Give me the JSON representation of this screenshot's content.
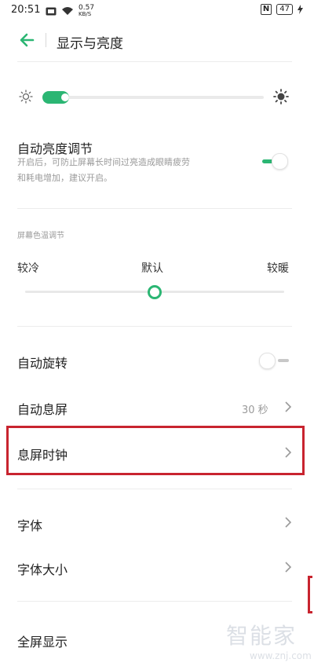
{
  "status_bar": {
    "time": "20:51",
    "speed_value": "0.57",
    "speed_unit": "KB/S",
    "battery": "47",
    "nfc": "N"
  },
  "header": {
    "title": "显示与亮度",
    "back_icon": "arrow-left-icon"
  },
  "colors": {
    "accent": "#2bb673",
    "highlight": "#c8242f"
  },
  "brightness": {
    "level": 0.06
  },
  "auto_brightness": {
    "title": "自动亮度调节",
    "subtitle_line1": "开启后，可防止屏幕长时间过亮造成眼睛疲劳",
    "subtitle_line2": "和耗电增加，建议开启。",
    "enabled": true
  },
  "color_temp": {
    "section_label": "屏幕色温调节",
    "cold": "较冷",
    "default": "默认",
    "warm": "较暖",
    "position": 0.5
  },
  "auto_rotate": {
    "title": "自动旋转",
    "enabled": false
  },
  "auto_sleep": {
    "title": "自动息屏",
    "value": "30 秒"
  },
  "aod_clock": {
    "title": "息屏时钟"
  },
  "font": {
    "title": "字体"
  },
  "font_size": {
    "title": "字体大小"
  },
  "full_screen": {
    "title": "全屏显示"
  },
  "watermark": {
    "main": "智能家",
    "url": "www.znj.com"
  }
}
